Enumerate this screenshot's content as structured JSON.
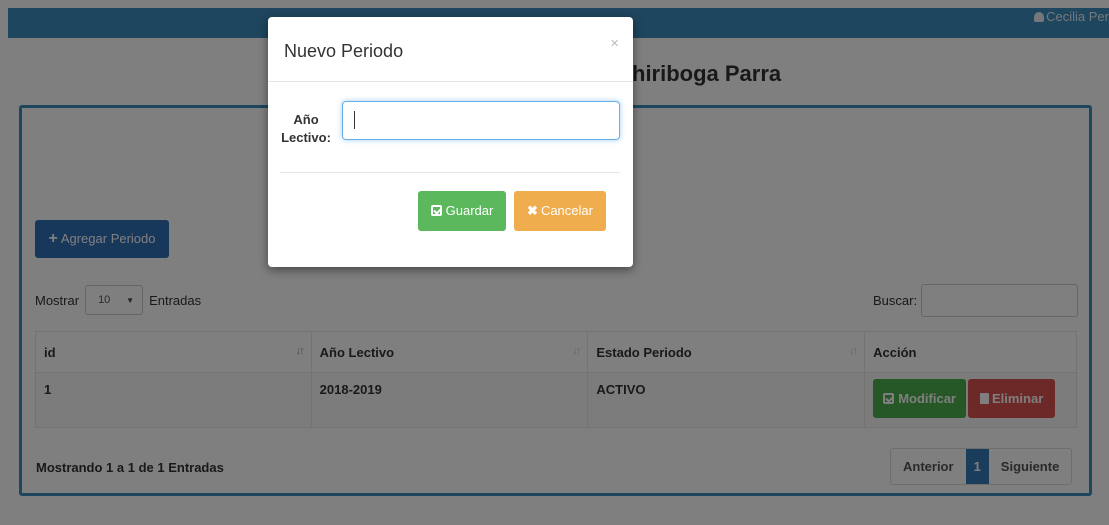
{
  "topbar": {
    "user": "Cecilia Per"
  },
  "page": {
    "heading": "hiriboga Parra"
  },
  "toolbar": {
    "add_label": "Agregar Periodo"
  },
  "table_controls": {
    "show_label": "Mostrar",
    "length_value": "10",
    "entries_label": "Entradas",
    "search_label": "Buscar:"
  },
  "table": {
    "columns": [
      "id",
      "Año Lectivo",
      "Estado Periodo",
      "Acción"
    ],
    "rows": [
      {
        "id": "1",
        "year": "2018-2019",
        "state": "ACTIVO",
        "edit_label": "Modificar",
        "delete_label": "Eliminar"
      }
    ]
  },
  "footer": {
    "info": "Mostrando 1 a 1 de 1 Entradas",
    "prev": "Anterior",
    "page": "1",
    "next": "Siguiente"
  },
  "modal": {
    "title": "Nuevo Periodo",
    "close": "×",
    "field_label_line1": "Año",
    "field_label_line2": "Lectivo:",
    "field_value": "",
    "save_label": "Guardar",
    "cancel_label": "Cancelar"
  },
  "colors": {
    "topbar": "#3c8dbc",
    "primary": "#3071b6",
    "success": "#5cb85c",
    "warning": "#f0ad4e",
    "danger": "#d9534f"
  }
}
